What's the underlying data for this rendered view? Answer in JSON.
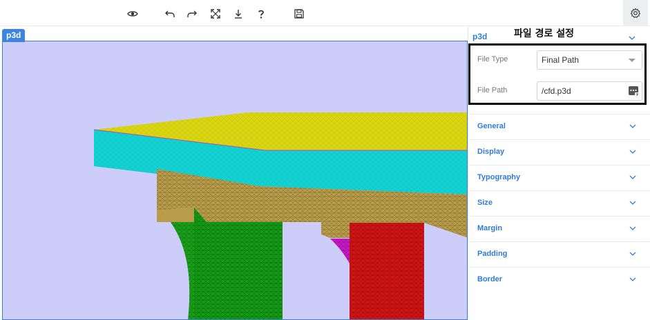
{
  "toolbar": {
    "icons": [
      "eye-icon",
      "undo-icon",
      "redo-icon",
      "fullscreen-icon",
      "download-icon",
      "help-icon",
      "save-icon"
    ],
    "settings_icon": "gear-icon"
  },
  "viewport": {
    "tag": "p3d"
  },
  "panel": {
    "heading": "p3d",
    "callout_title": "파일 경로 설정",
    "file_type": {
      "label": "File Type",
      "value": "Final Path"
    },
    "file_path": {
      "label": "File Path",
      "value": "/cfd.p3d"
    },
    "sections": [
      "General",
      "Display",
      "Typography",
      "Size",
      "Margin",
      "Padding",
      "Border"
    ]
  },
  "colors": {
    "accent": "#2f7bd8",
    "viewport_background": "#cdcdfa",
    "mesh_top": "#d9d611",
    "mesh_front": "#13d2d2",
    "mesh_beam": "#b89c4a",
    "mesh_left_leg": "#149a14",
    "mesh_right_leg": "#d01414",
    "mesh_curve": "#c718c7"
  }
}
